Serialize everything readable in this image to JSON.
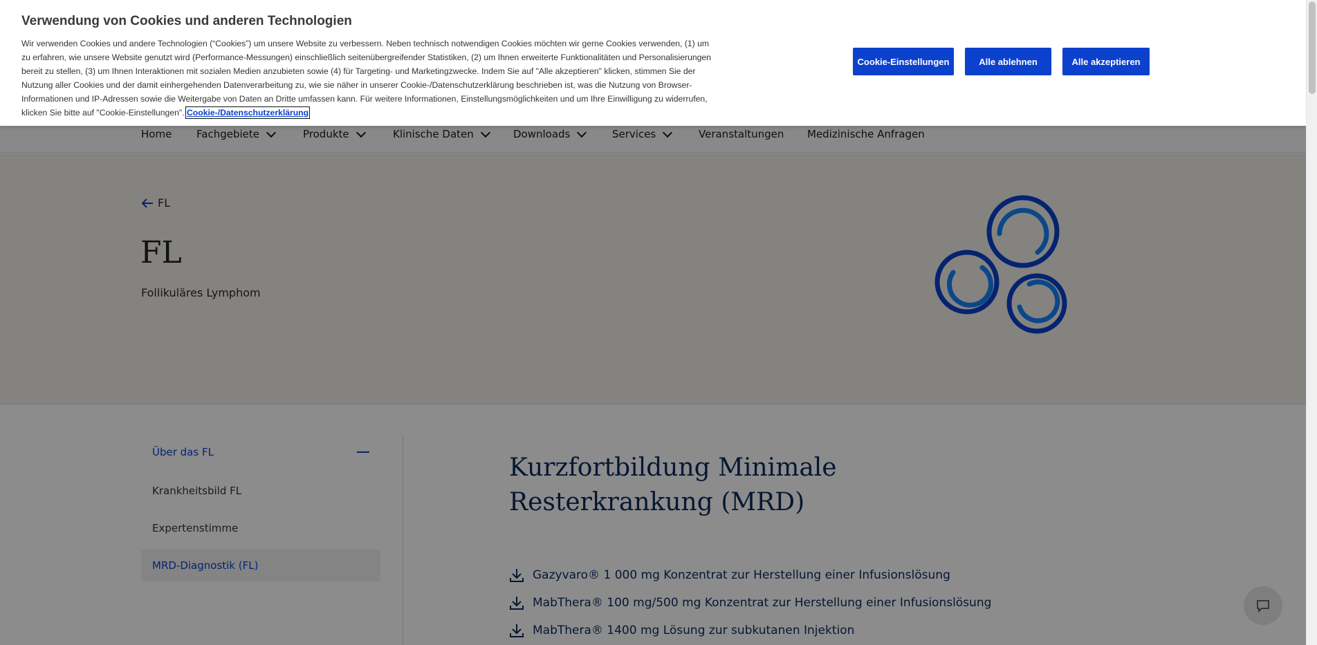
{
  "nav": {
    "items": [
      {
        "label": "Home",
        "has_dropdown": false
      },
      {
        "label": "Fachgebiete",
        "has_dropdown": true
      },
      {
        "label": "Produkte",
        "has_dropdown": true
      },
      {
        "label": "Klinische Daten",
        "has_dropdown": true
      },
      {
        "label": "Downloads",
        "has_dropdown": true
      },
      {
        "label": "Services",
        "has_dropdown": true
      },
      {
        "label": "Veranstaltungen",
        "has_dropdown": false
      },
      {
        "label": "Medizinische Anfragen",
        "has_dropdown": false
      }
    ]
  },
  "hero": {
    "back_label": "FL",
    "title": "FL",
    "subtitle": "Follikuläres Lymphom"
  },
  "sidebar": {
    "header": "Über das FL",
    "items": [
      {
        "label": "Krankheitsbild FL",
        "active": false
      },
      {
        "label": "Expertenstimme",
        "active": false
      },
      {
        "label": "MRD-Diagnostik (FL)",
        "active": true
      }
    ]
  },
  "main": {
    "title": "Kurzfortbildung Minimale Resterkrankung (MRD)",
    "downloads": [
      {
        "label": "Gazyvaro® 1 000 mg Konzentrat zur Herstellung einer Infusionslösung"
      },
      {
        "label": "MabThera® 100 mg/500 mg Konzentrat zur Herstellung einer Infusionslösung"
      },
      {
        "label": "MabThera® 1400 mg Lösung zur subkutanen Injektion"
      }
    ]
  },
  "cookie": {
    "title": "Verwendung von Cookies und anderen Technologien",
    "text": "Wir verwenden Cookies und andere Technologien (“Cookies”) um unsere Website zu verbessern. Neben technisch notwendigen Cookies möchten wir gerne Cookies verwenden, (1) um zu erfahren, wie unsere Website genutzt wird (Performance-Messungen) einschließlich seitenübergreifender Statistiken, (2) um Ihnen erweiterte Funktionalitäten und Personalisierungen bereit zu stellen, (3) um Ihnen Interaktionen mit sozialen Medien anzubieten sowie (4) für Targeting- und Marketingzwecke. Indem Sie auf \"Alle akzeptieren\" klicken, stimmen Sie der Nutzung aller Cookies und der damit einhergehenden Datenverarbeitung zu, wie sie näher in unserer Cookie-/Datenschutzerklärung beschrieben ist, was die Nutzung von Browser-Informationen und IP-Adressen sowie die Weitergabe von Daten an Dritte umfassen kann. Für weitere Informationen, Einstellungsmöglichkeiten und um Ihre Einwilligung zu widerrufen, klicken Sie bitte auf \"Cookie-Einstellungen\".",
    "link_label": "Cookie-/Datenschutzerklärung",
    "buttons": {
      "settings": "Cookie-Einstellungen",
      "reject": "Alle ablehnen",
      "accept": "Alle akzeptieren"
    }
  },
  "colors": {
    "accent": "#0b41cd",
    "hero_bg": "#f3eee9",
    "title_navy": "#0b2a5c"
  },
  "icons": {
    "back": "arrow-left-icon",
    "download": "download-icon",
    "chat": "chat-icon",
    "dropdown": "chevron-down-icon"
  }
}
